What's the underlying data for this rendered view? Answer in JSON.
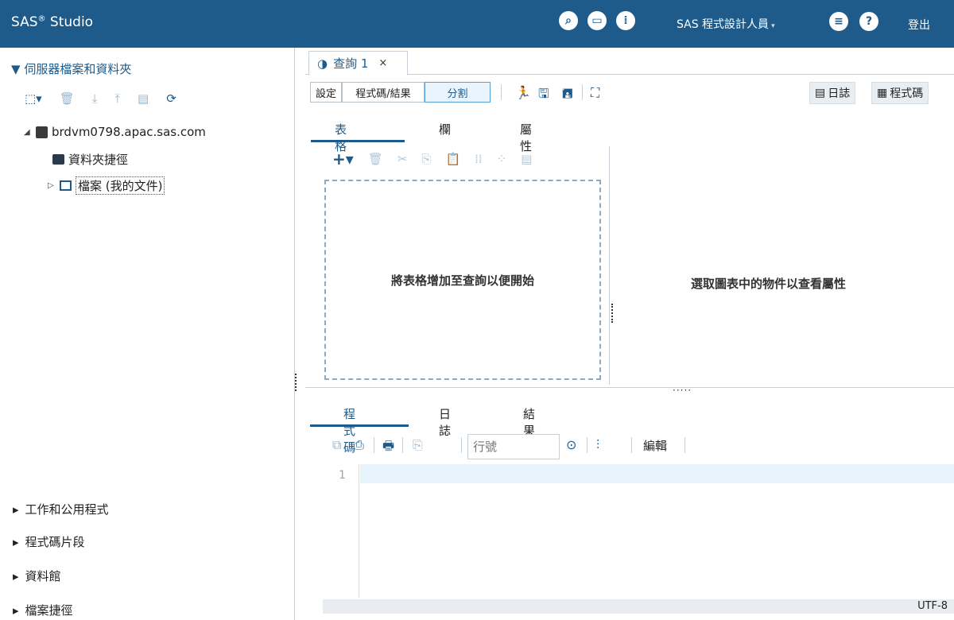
{
  "header": {
    "app_name": "SAS",
    "app_name_suffix": " Studio",
    "registered_mark": "®",
    "role": "SAS 程式設計人員",
    "role_caret": "▾",
    "logout": "登出",
    "help_glyph": "?"
  },
  "left": {
    "header_triangle": "▼",
    "header_label": "伺服器檔案和資料夾",
    "server_name": "brdvm0798.apac.sas.com",
    "folder_shortcuts": "資料夾捷徑",
    "files_node": "檔案 (我的文件)",
    "sections": [
      "工作和公用程式",
      "程式碼片段",
      "資料館",
      "檔案捷徑"
    ]
  },
  "tab": {
    "label": "查詢 1",
    "close": "×"
  },
  "query_toolbar": {
    "settings": "設定",
    "code_results": "程式碼/結果",
    "split": "分割",
    "log_btn": "日誌",
    "code_btn": "程式碼"
  },
  "subtabs": [
    "表格",
    "欄",
    "屬性"
  ],
  "dropzone_text": "將表格增加至查詢以便開始",
  "properties_text": "選取圖表中的物件以查看屬性",
  "code_tabs": [
    "程式碼",
    "日誌",
    "結果"
  ],
  "code_toolbar": {
    "line_placeholder": "行號",
    "edit_label": "編輯"
  },
  "editor": {
    "line_number": "1"
  },
  "status": {
    "encoding": "UTF-8"
  },
  "colors": {
    "topbar": "#1f5b8a",
    "accent": "#1f5b8a",
    "active_line": "#e8f4fb"
  }
}
